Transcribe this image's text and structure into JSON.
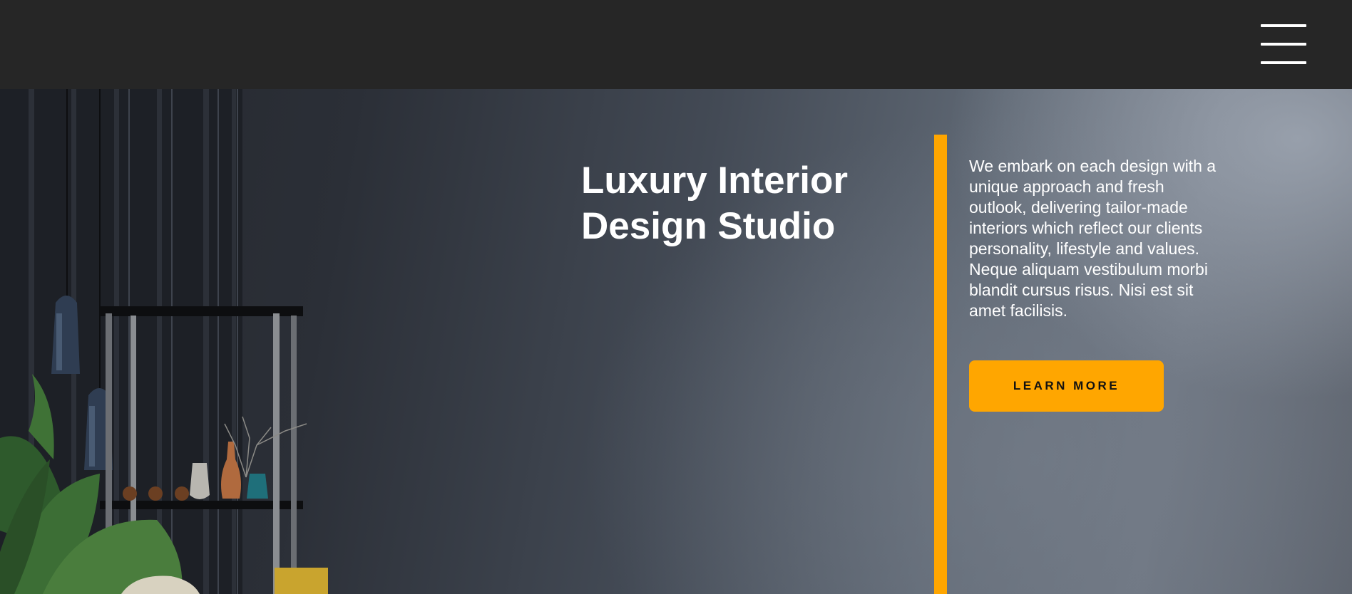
{
  "header": {
    "menu_icon": "hamburger-menu-icon"
  },
  "hero": {
    "title": "Luxury Interior Design Studio",
    "description": "We embark on each design with a unique approach and fresh outlook, delivering tailor-made interiors which reflect our clients personality, lifestyle and values. Neque aliquam vestibulum morbi blandit cursus risus. Nisi est sit amet facilisis.",
    "cta_label": "LEARN MORE"
  },
  "colors": {
    "accent": "#ffa600",
    "header_bg": "#262626",
    "text": "#ffffff"
  }
}
